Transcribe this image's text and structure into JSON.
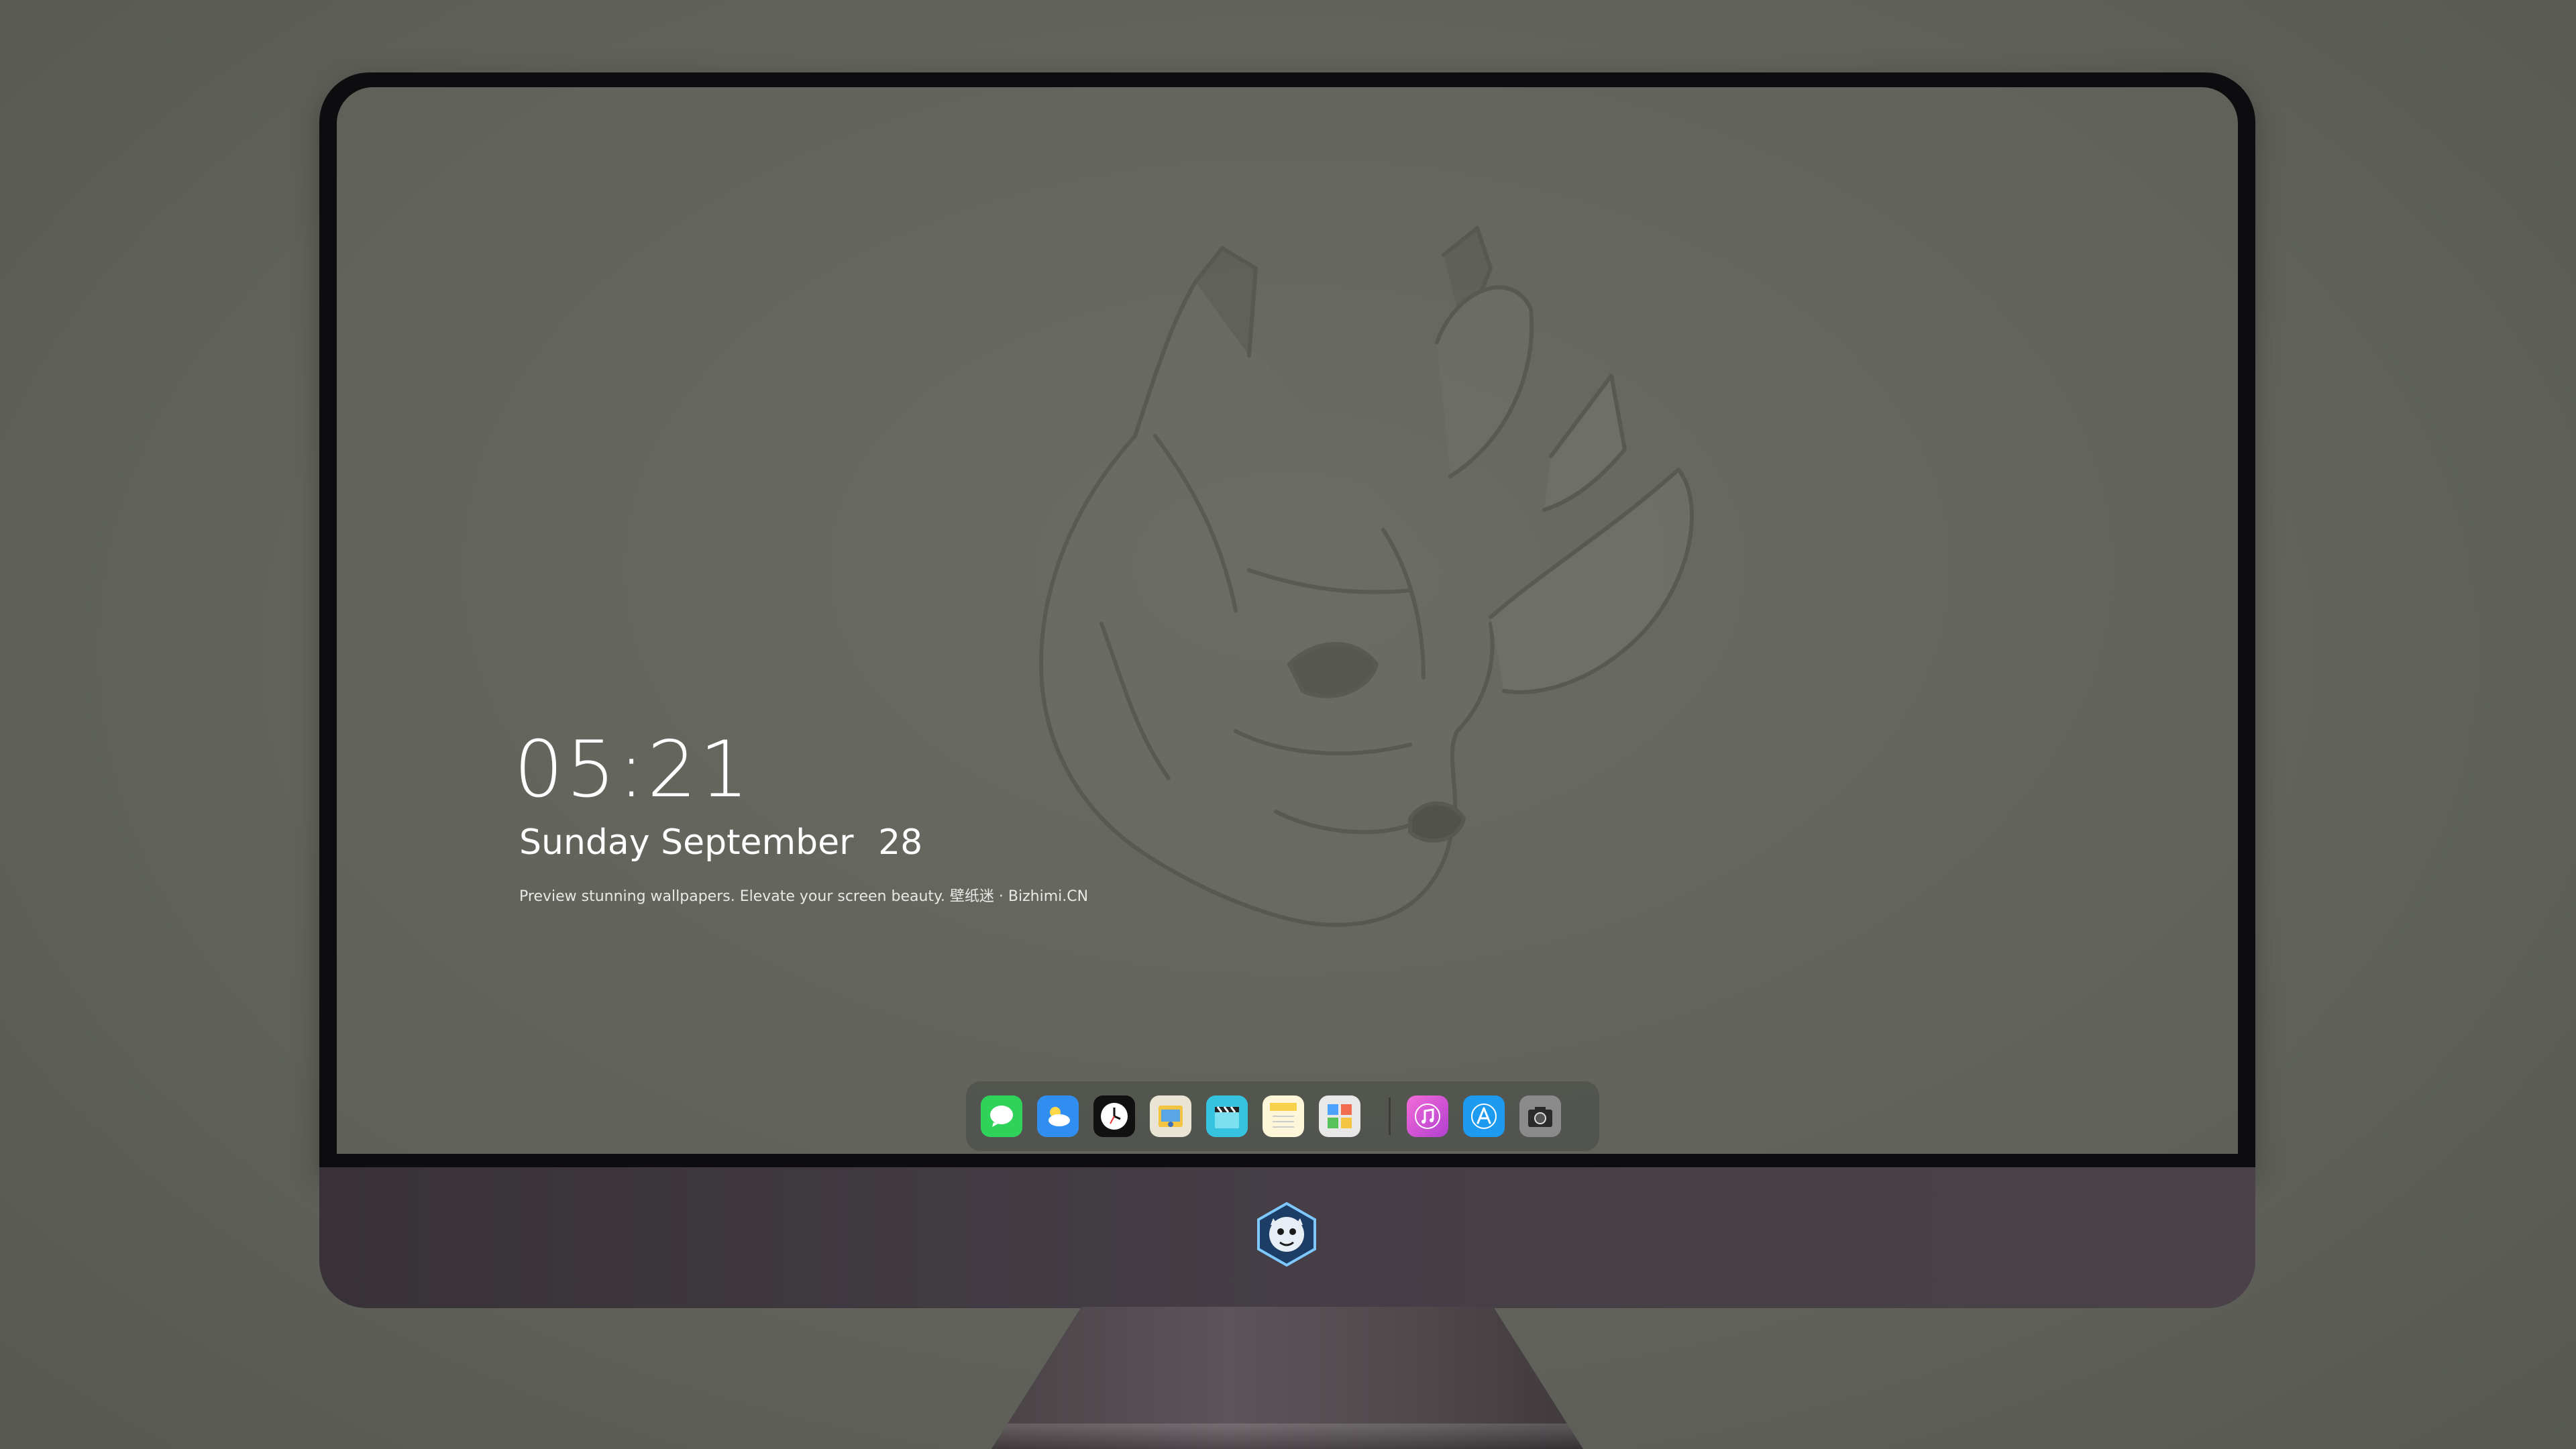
{
  "lockscreen": {
    "time": "05:21",
    "weekday": "Sunday",
    "month": "September",
    "day": "28",
    "tagline": "Preview stunning wallpapers. Elevate your screen beauty. 壁纸迷 · Bizhimi.CN"
  },
  "dock": {
    "apps": [
      {
        "name": "Messages",
        "icon": "messages-icon",
        "color": "#2fd35a"
      },
      {
        "name": "Weather",
        "icon": "weather-icon",
        "color": "#2f8ef0"
      },
      {
        "name": "Clock",
        "icon": "clock-icon",
        "color": "#111111"
      },
      {
        "name": "Preview",
        "icon": "preview-icon",
        "color": "#f4c542"
      },
      {
        "name": "Clips",
        "icon": "clapperboard-icon",
        "color": "#36c3e0"
      },
      {
        "name": "Notes",
        "icon": "notes-icon",
        "color": "#f7d14a"
      },
      {
        "name": "Photo Booth",
        "icon": "photo-gallery-icon",
        "color": "#e8e8e8"
      },
      {
        "name": "iTunes",
        "icon": "music-note-icon",
        "color": "#e24cd2"
      },
      {
        "name": "App Store",
        "icon": "app-store-icon",
        "color": "#1d9bf0"
      },
      {
        "name": "Camera",
        "icon": "camera-icon",
        "color": "#8a8a8a"
      }
    ]
  },
  "colors": {
    "wallpaper": "#64665e",
    "bezel": "#0d0d0f",
    "chin": "#453e46"
  }
}
